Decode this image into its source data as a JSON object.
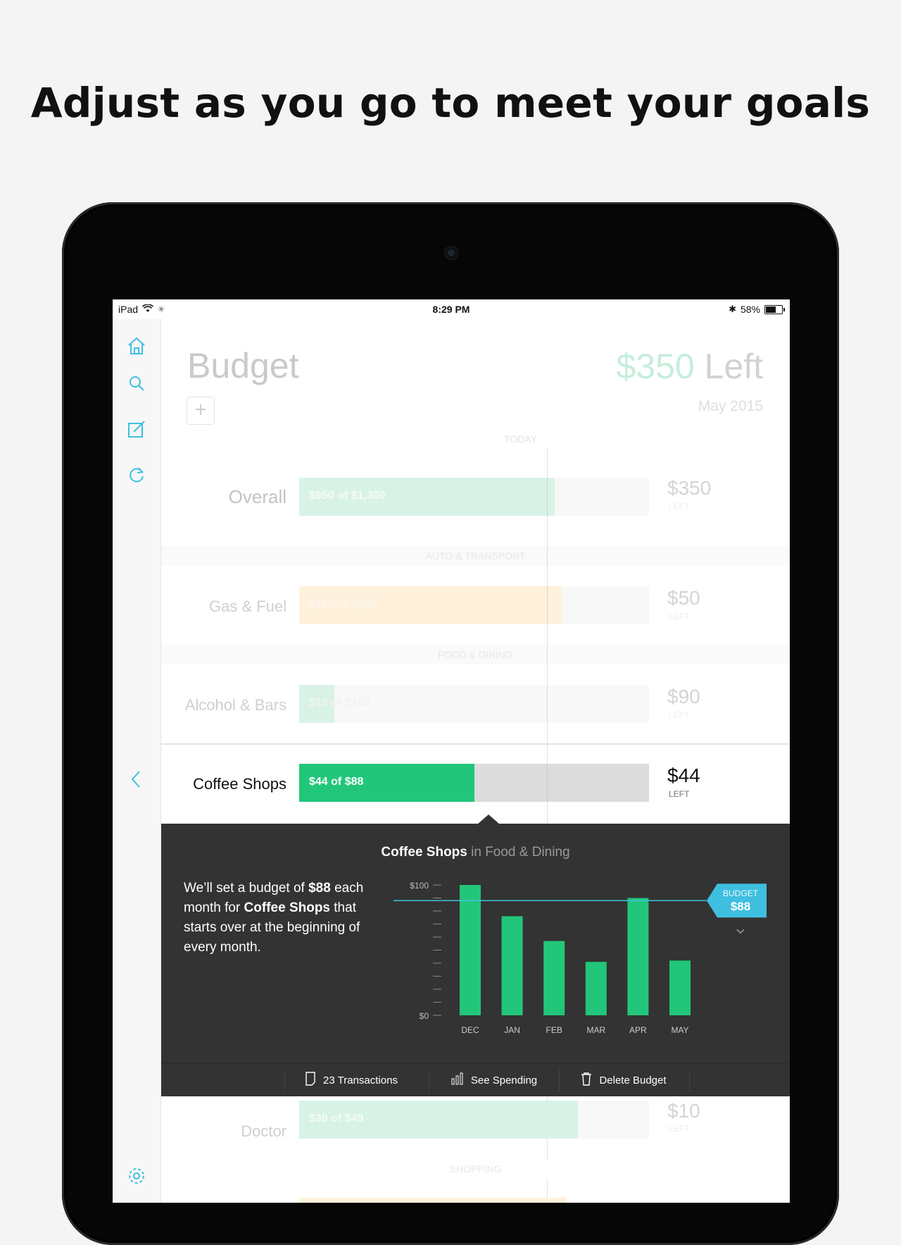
{
  "headline": "Adjust as you go to meet your goals",
  "status_bar": {
    "device": "iPad",
    "time": "8:29 PM",
    "battery": "58%"
  },
  "sidebar": {
    "icons": [
      "home-icon",
      "search-icon",
      "compose-icon",
      "refresh-icon",
      "back-icon",
      "gear-icon"
    ]
  },
  "header": {
    "title": "Budget",
    "add_label": "+",
    "amount_left": "$350",
    "left_label": "Left",
    "month": "May 2015",
    "today_label": "TODAY"
  },
  "sections": {
    "auto": "AUTO & TRANSPORT",
    "food": "FOOD & DINING",
    "shopping": "SHOPPING"
  },
  "rows": {
    "overall": {
      "label": "Overall",
      "bar_text": "$950 of $1,300",
      "spent": 950,
      "budget": 1300,
      "amount": "$350",
      "sub": "LEFT"
    },
    "gas": {
      "label": "Gas & Fuel",
      "bar_text": "$150 of $200",
      "spent": 150,
      "budget": 200,
      "amount": "$50",
      "sub": "LEFT"
    },
    "alcohol": {
      "label": "Alcohol & Bars",
      "bar_text": "$10 of $100",
      "spent": 10,
      "budget": 100,
      "amount": "$90",
      "sub": "LEFT"
    },
    "coffee": {
      "label": "Coffee Shops",
      "bar_text": "$44 of $88",
      "spent": 44,
      "budget": 88,
      "amount": "$44",
      "sub": "LEFT"
    },
    "doctor": {
      "label": "Doctor",
      "bar_text": "$39 of $49",
      "spent": 39,
      "budget": 49,
      "amount": "$10",
      "sub": "LEFT"
    }
  },
  "panel": {
    "title_strong": "Coffee Shops",
    "title_muted": "in Food & Dining",
    "desc_1": "We’ll set a budget of ",
    "desc_amount": "$88",
    "desc_2": " each month for ",
    "desc_category": "Coffee Shops",
    "desc_3": " that starts over at the beginning of every month.",
    "budget_tag_label": "BUDGET",
    "budget_tag_value": "$88",
    "actions": {
      "transactions": "23 Transactions",
      "spending": "See Spending",
      "delete": "Delete Budget"
    }
  },
  "colors": {
    "green": "#22c67a",
    "light_green": "#d8f3e6",
    "light_orange": "#fff1dc",
    "accent_blue": "#3fbfe0",
    "panel_bg": "#333333"
  },
  "chart_data": {
    "type": "bar",
    "categories": [
      "DEC",
      "JAN",
      "FEB",
      "MAR",
      "APR",
      "MAY"
    ],
    "values": [
      100,
      76,
      57,
      41,
      90,
      42
    ],
    "ylim": [
      0,
      100
    ],
    "y_tick_labels": [
      "$100",
      "$0"
    ],
    "budget_line": 88,
    "title": "",
    "xlabel": "",
    "ylabel": ""
  }
}
